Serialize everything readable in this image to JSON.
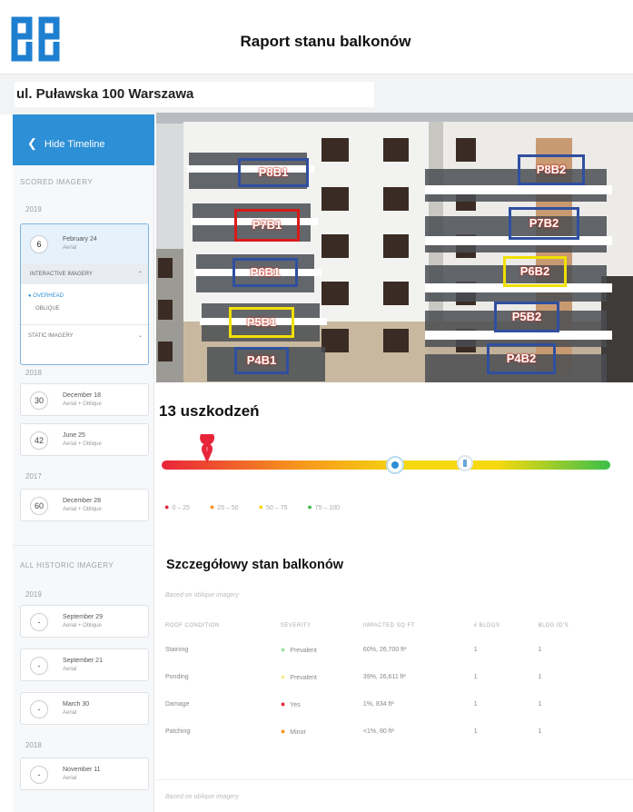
{
  "header": {
    "title": "Raport stanu balkonów"
  },
  "address": "ul. Puławska 100 Warszawa",
  "sidebar": {
    "hide_label": "Hide Timeline",
    "scored_label": "SCORED IMAGERY",
    "year_2019": "2019",
    "active": {
      "num": "6",
      "date": "February 24",
      "sub": "Aerial"
    },
    "interactive_label": "INTERACTIVE IMAGERY",
    "overhead_label": "OVERHEAD",
    "oblique_label": "OBLIQUE",
    "static_label": "STATIC IMAGERY",
    "year_2018": "2018",
    "cards_2018": [
      {
        "num": "30",
        "date": "December 18",
        "sub": "Aerial + Oblique"
      },
      {
        "num": "42",
        "date": "June 25",
        "sub": "Aerial + Oblique"
      }
    ],
    "year_2017": "2017",
    "card_2017": {
      "num": "60",
      "date": "December 28",
      "sub": "Aerial + Oblique"
    },
    "historic_label": "ALL HISTORIC IMAGERY",
    "year_2019b": "2019",
    "historic_2019": [
      {
        "num": "-",
        "date": "September 29",
        "sub": "Aerial + Oblique"
      },
      {
        "num": "-",
        "date": "September 21",
        "sub": "Aerial"
      },
      {
        "num": "-",
        "date": "March 30",
        "sub": "Aerial"
      }
    ],
    "year_2018b": "2018",
    "historic_2018": [
      {
        "num": "-",
        "date": "November 11",
        "sub": "Aerial"
      }
    ]
  },
  "balcony_tags": [
    "P8B1",
    "P8B2",
    "P7B1",
    "P7B2",
    "P6B1",
    "P6B2",
    "P5B1",
    "P5B2",
    "P4B1",
    "P4B2"
  ],
  "damage_count": "13 uszkodzeń",
  "gauge": {
    "colors": {
      "red": "#e8243a",
      "orange": "#f7941d",
      "yellow": "#f6d90f",
      "green": "#3cbf4a"
    },
    "legend": [
      {
        "color": "#e8243a",
        "label": "0 – 25"
      },
      {
        "color": "#f7941d",
        "label": "25 – 50"
      },
      {
        "color": "#f6d90f",
        "label": "50 – 75"
      },
      {
        "color": "#3cbf4a",
        "label": "75 – 100"
      }
    ]
  },
  "details": {
    "title": "Szczegółowy stan balkonów",
    "based_label": "Based on oblique imagery",
    "columns": [
      "ROOF CONDITION",
      "SEVERITY",
      "IMPACTED SQ FT",
      "# BLDGS",
      "BLDG ID'S"
    ],
    "rows": [
      {
        "cond": "Staining",
        "sev_color": "#9be0a6",
        "sev": "Prevalent",
        "sqft": "60%, 26,700 ft²",
        "bldgs": "1",
        "ids": "1"
      },
      {
        "cond": "Ponding",
        "sev_color": "#f6ef8f",
        "sev": "Prevalent",
        "sqft": "39%, 26,611 ft²",
        "bldgs": "1",
        "ids": "1"
      },
      {
        "cond": "Damage",
        "sev_color": "#e8243a",
        "sev": "Yes",
        "sqft": "1%, 834 ft²",
        "bldgs": "1",
        "ids": "1"
      },
      {
        "cond": "Patching",
        "sev_color": "#f7941d",
        "sev": "Minor",
        "sqft": "<1%, 80 ft²",
        "bldgs": "1",
        "ids": "1"
      }
    ],
    "footer_based": "Based on oblique imagery"
  }
}
